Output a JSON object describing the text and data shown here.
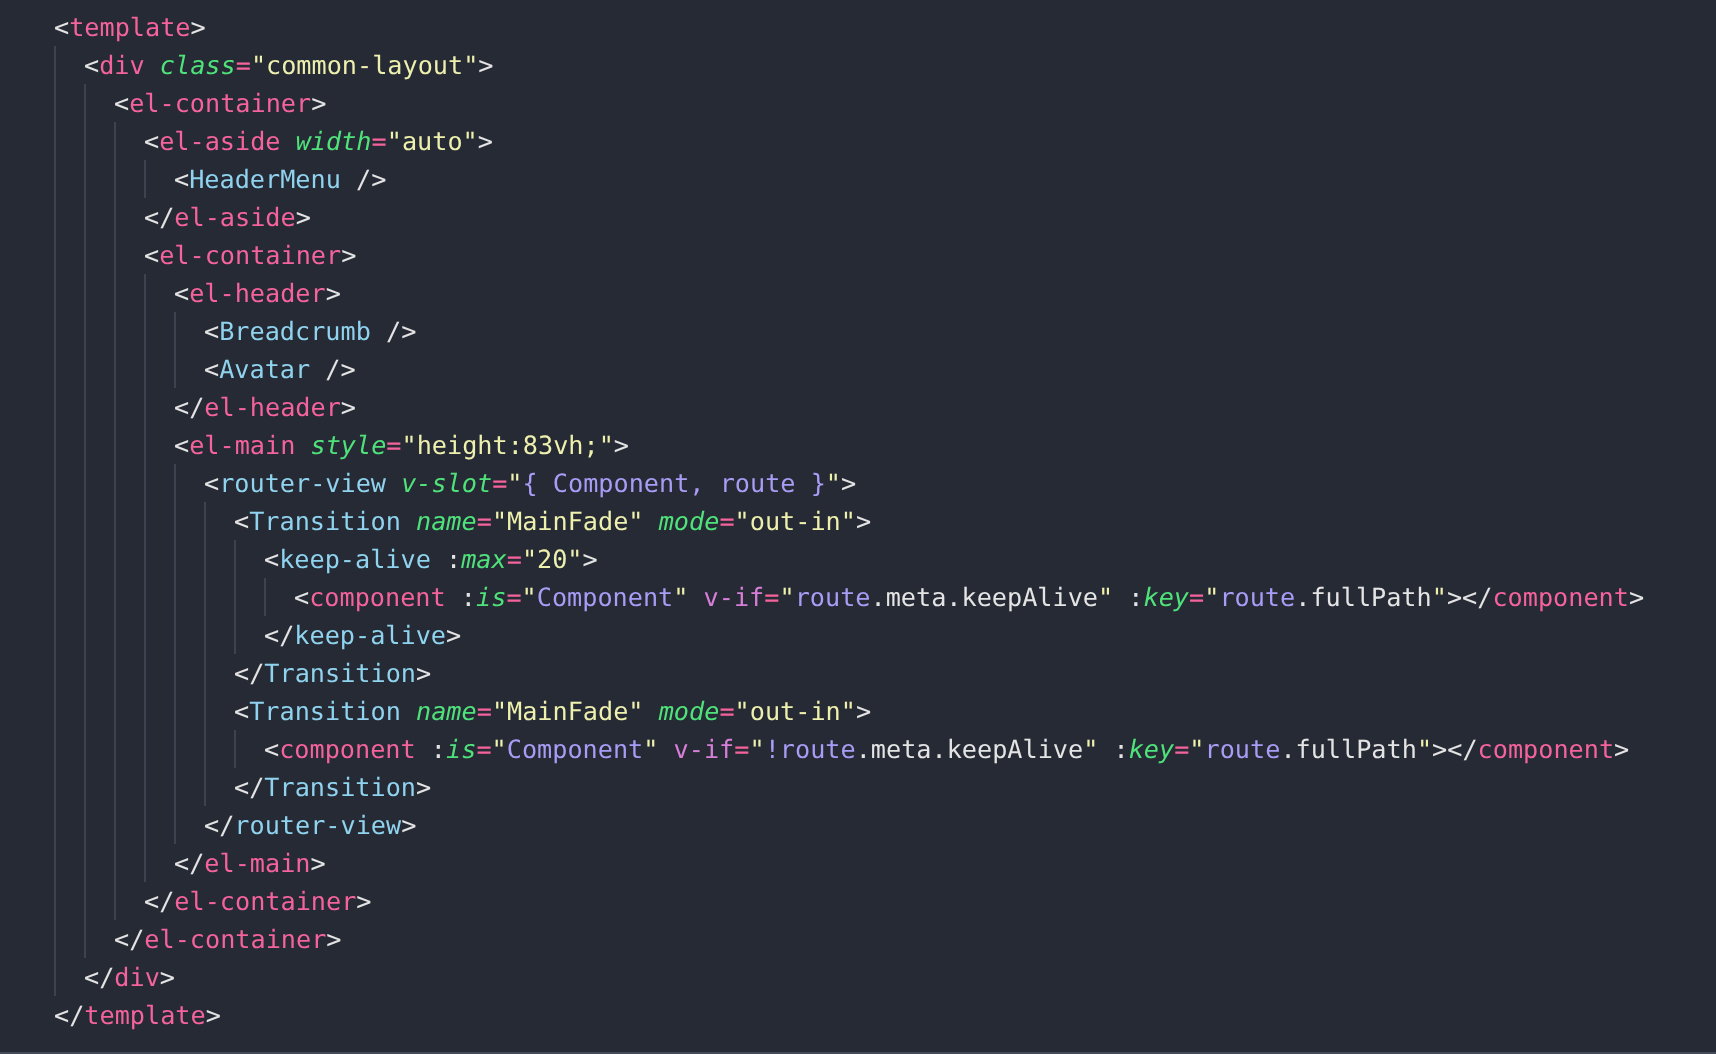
{
  "code": [
    {
      "tokens": [
        {
          "kind": "p",
          "text": "<"
        },
        {
          "kind": "tag",
          "text": "template"
        },
        {
          "kind": "p",
          "text": ">"
        }
      ],
      "children": [
        {
          "tokens": [
            {
              "kind": "p",
              "text": "<"
            },
            {
              "kind": "tag",
              "text": "div"
            },
            {
              "kind": "attr",
              "text": " class"
            },
            {
              "kind": "eq",
              "text": "="
            },
            {
              "kind": "str",
              "text": "\"common-layout\""
            },
            {
              "kind": "p",
              "text": ">"
            }
          ],
          "children": [
            {
              "tokens": [
                {
                  "kind": "p",
                  "text": "<"
                },
                {
                  "kind": "tag",
                  "text": "el-container"
                },
                {
                  "kind": "p",
                  "text": ">"
                }
              ],
              "children": [
                {
                  "tokens": [
                    {
                      "kind": "p",
                      "text": "<"
                    },
                    {
                      "kind": "tag",
                      "text": "el-aside"
                    },
                    {
                      "kind": "attr",
                      "text": " width"
                    },
                    {
                      "kind": "eq",
                      "text": "="
                    },
                    {
                      "kind": "str",
                      "text": "\"auto\""
                    },
                    {
                      "kind": "p",
                      "text": ">"
                    }
                  ],
                  "children": [
                    {
                      "tokens": [
                        {
                          "kind": "p",
                          "text": "<"
                        },
                        {
                          "kind": "comp",
                          "text": "HeaderMenu"
                        },
                        {
                          "kind": "p",
                          "text": " />"
                        }
                      ]
                    }
                  ]
                },
                {
                  "tokens": [
                    {
                      "kind": "p",
                      "text": "</"
                    },
                    {
                      "kind": "tag",
                      "text": "el-aside"
                    },
                    {
                      "kind": "p",
                      "text": ">"
                    }
                  ]
                },
                {
                  "tokens": [
                    {
                      "kind": "p",
                      "text": "<"
                    },
                    {
                      "kind": "tag",
                      "text": "el-container"
                    },
                    {
                      "kind": "p",
                      "text": ">"
                    }
                  ],
                  "children": [
                    {
                      "tokens": [
                        {
                          "kind": "p",
                          "text": "<"
                        },
                        {
                          "kind": "tag",
                          "text": "el-header"
                        },
                        {
                          "kind": "p",
                          "text": ">"
                        }
                      ],
                      "children": [
                        {
                          "tokens": [
                            {
                              "kind": "p",
                              "text": "<"
                            },
                            {
                              "kind": "comp",
                              "text": "Breadcrumb"
                            },
                            {
                              "kind": "p",
                              "text": " />"
                            }
                          ]
                        },
                        {
                          "tokens": [
                            {
                              "kind": "p",
                              "text": "<"
                            },
                            {
                              "kind": "comp",
                              "text": "Avatar"
                            },
                            {
                              "kind": "p",
                              "text": " />"
                            }
                          ]
                        }
                      ]
                    },
                    {
                      "tokens": [
                        {
                          "kind": "p",
                          "text": "</"
                        },
                        {
                          "kind": "tag",
                          "text": "el-header"
                        },
                        {
                          "kind": "p",
                          "text": ">"
                        }
                      ]
                    },
                    {
                      "tokens": [
                        {
                          "kind": "p",
                          "text": "<"
                        },
                        {
                          "kind": "tag",
                          "text": "el-main"
                        },
                        {
                          "kind": "attr",
                          "text": " style"
                        },
                        {
                          "kind": "eq",
                          "text": "="
                        },
                        {
                          "kind": "str",
                          "text": "\"height:83vh;\""
                        },
                        {
                          "kind": "p",
                          "text": ">"
                        }
                      ],
                      "children": [
                        {
                          "tokens": [
                            {
                              "kind": "p",
                              "text": "<"
                            },
                            {
                              "kind": "comp",
                              "text": "router-view"
                            },
                            {
                              "kind": "attr",
                              "text": " v-slot"
                            },
                            {
                              "kind": "eq",
                              "text": "="
                            },
                            {
                              "kind": "str",
                              "text": "\""
                            },
                            {
                              "kind": "expr",
                              "text": "{ Component, route }"
                            },
                            {
                              "kind": "str",
                              "text": "\""
                            },
                            {
                              "kind": "p",
                              "text": ">"
                            }
                          ],
                          "children": [
                            {
                              "tokens": [
                                {
                                  "kind": "p",
                                  "text": "<"
                                },
                                {
                                  "kind": "comp",
                                  "text": "Transition"
                                },
                                {
                                  "kind": "attr",
                                  "text": " name"
                                },
                                {
                                  "kind": "eq",
                                  "text": "="
                                },
                                {
                                  "kind": "str",
                                  "text": "\"MainFade\""
                                },
                                {
                                  "kind": "attr",
                                  "text": " mode"
                                },
                                {
                                  "kind": "eq",
                                  "text": "="
                                },
                                {
                                  "kind": "str",
                                  "text": "\"out-in\""
                                },
                                {
                                  "kind": "p",
                                  "text": ">"
                                }
                              ],
                              "children": [
                                {
                                  "tokens": [
                                    {
                                      "kind": "p",
                                      "text": "<"
                                    },
                                    {
                                      "kind": "comp",
                                      "text": "keep-alive"
                                    },
                                    {
                                      "kind": "p",
                                      "text": " :"
                                    },
                                    {
                                      "kind": "attr",
                                      "text": "max"
                                    },
                                    {
                                      "kind": "eq",
                                      "text": "="
                                    },
                                    {
                                      "kind": "str",
                                      "text": "\"20\""
                                    },
                                    {
                                      "kind": "p",
                                      "text": ">"
                                    }
                                  ],
                                  "children": [
                                    {
                                      "tokens": [
                                        {
                                          "kind": "p",
                                          "text": "<"
                                        },
                                        {
                                          "kind": "tag",
                                          "text": "component"
                                        },
                                        {
                                          "kind": "p",
                                          "text": " :"
                                        },
                                        {
                                          "kind": "attr",
                                          "text": "is"
                                        },
                                        {
                                          "kind": "eq",
                                          "text": "="
                                        },
                                        {
                                          "kind": "str",
                                          "text": "\""
                                        },
                                        {
                                          "kind": "expr",
                                          "text": "Component"
                                        },
                                        {
                                          "kind": "str",
                                          "text": "\""
                                        },
                                        {
                                          "kind": "dir",
                                          "text": " v-if"
                                        },
                                        {
                                          "kind": "eq",
                                          "text": "="
                                        },
                                        {
                                          "kind": "str",
                                          "text": "\""
                                        },
                                        {
                                          "kind": "expr",
                                          "text": "route"
                                        },
                                        {
                                          "kind": "p",
                                          "text": ".meta.keepAlive"
                                        },
                                        {
                                          "kind": "str",
                                          "text": "\""
                                        },
                                        {
                                          "kind": "p",
                                          "text": " :"
                                        },
                                        {
                                          "kind": "attr",
                                          "text": "key"
                                        },
                                        {
                                          "kind": "eq",
                                          "text": "="
                                        },
                                        {
                                          "kind": "str",
                                          "text": "\""
                                        },
                                        {
                                          "kind": "expr",
                                          "text": "route"
                                        },
                                        {
                                          "kind": "p",
                                          "text": ".fullPath"
                                        },
                                        {
                                          "kind": "str",
                                          "text": "\""
                                        },
                                        {
                                          "kind": "p",
                                          "text": "></"
                                        },
                                        {
                                          "kind": "tag",
                                          "text": "component"
                                        },
                                        {
                                          "kind": "p",
                                          "text": ">"
                                        }
                                      ]
                                    }
                                  ]
                                },
                                {
                                  "tokens": [
                                    {
                                      "kind": "p",
                                      "text": "</"
                                    },
                                    {
                                      "kind": "comp",
                                      "text": "keep-alive"
                                    },
                                    {
                                      "kind": "p",
                                      "text": ">"
                                    }
                                  ]
                                }
                              ]
                            },
                            {
                              "tokens": [
                                {
                                  "kind": "p",
                                  "text": "</"
                                },
                                {
                                  "kind": "comp",
                                  "text": "Transition"
                                },
                                {
                                  "kind": "p",
                                  "text": ">"
                                }
                              ]
                            },
                            {
                              "tokens": [
                                {
                                  "kind": "p",
                                  "text": "<"
                                },
                                {
                                  "kind": "comp",
                                  "text": "Transition"
                                },
                                {
                                  "kind": "attr",
                                  "text": " name"
                                },
                                {
                                  "kind": "eq",
                                  "text": "="
                                },
                                {
                                  "kind": "str",
                                  "text": "\"MainFade\""
                                },
                                {
                                  "kind": "attr",
                                  "text": " mode"
                                },
                                {
                                  "kind": "eq",
                                  "text": "="
                                },
                                {
                                  "kind": "str",
                                  "text": "\"out-in\""
                                },
                                {
                                  "kind": "p",
                                  "text": ">"
                                }
                              ],
                              "children": [
                                {
                                  "tokens": [
                                    {
                                      "kind": "p",
                                      "text": "<"
                                    },
                                    {
                                      "kind": "tag",
                                      "text": "component"
                                    },
                                    {
                                      "kind": "p",
                                      "text": " :"
                                    },
                                    {
                                      "kind": "attr",
                                      "text": "is"
                                    },
                                    {
                                      "kind": "eq",
                                      "text": "="
                                    },
                                    {
                                      "kind": "str",
                                      "text": "\""
                                    },
                                    {
                                      "kind": "expr",
                                      "text": "Component"
                                    },
                                    {
                                      "kind": "str",
                                      "text": "\""
                                    },
                                    {
                                      "kind": "dir",
                                      "text": " v-if"
                                    },
                                    {
                                      "kind": "eq",
                                      "text": "="
                                    },
                                    {
                                      "kind": "str",
                                      "text": "\""
                                    },
                                    {
                                      "kind": "expr",
                                      "text": "!route"
                                    },
                                    {
                                      "kind": "p",
                                      "text": ".meta.keepAlive"
                                    },
                                    {
                                      "kind": "str",
                                      "text": "\""
                                    },
                                    {
                                      "kind": "p",
                                      "text": " :"
                                    },
                                    {
                                      "kind": "attr",
                                      "text": "key"
                                    },
                                    {
                                      "kind": "eq",
                                      "text": "="
                                    },
                                    {
                                      "kind": "str",
                                      "text": "\""
                                    },
                                    {
                                      "kind": "expr",
                                      "text": "route"
                                    },
                                    {
                                      "kind": "p",
                                      "text": ".fullPath"
                                    },
                                    {
                                      "kind": "str",
                                      "text": "\""
                                    },
                                    {
                                      "kind": "p",
                                      "text": "></"
                                    },
                                    {
                                      "kind": "tag",
                                      "text": "component"
                                    },
                                    {
                                      "kind": "p",
                                      "text": ">"
                                    }
                                  ]
                                }
                              ]
                            },
                            {
                              "tokens": [
                                {
                                  "kind": "p",
                                  "text": "</"
                                },
                                {
                                  "kind": "comp",
                                  "text": "Transition"
                                },
                                {
                                  "kind": "p",
                                  "text": ">"
                                }
                              ]
                            }
                          ]
                        },
                        {
                          "tokens": [
                            {
                              "kind": "p",
                              "text": "</"
                            },
                            {
                              "kind": "comp",
                              "text": "router-view"
                            },
                            {
                              "kind": "p",
                              "text": ">"
                            }
                          ]
                        }
                      ]
                    },
                    {
                      "tokens": [
                        {
                          "kind": "p",
                          "text": "</"
                        },
                        {
                          "kind": "tag",
                          "text": "el-main"
                        },
                        {
                          "kind": "p",
                          "text": ">"
                        }
                      ]
                    }
                  ]
                },
                {
                  "tokens": [
                    {
                      "kind": "p",
                      "text": "</"
                    },
                    {
                      "kind": "tag",
                      "text": "el-container"
                    },
                    {
                      "kind": "p",
                      "text": ">"
                    }
                  ]
                }
              ]
            },
            {
              "tokens": [
                {
                  "kind": "p",
                  "text": "</"
                },
                {
                  "kind": "tag",
                  "text": "el-container"
                },
                {
                  "kind": "p",
                  "text": ">"
                }
              ]
            }
          ]
        },
        {
          "tokens": [
            {
              "kind": "p",
              "text": "</"
            },
            {
              "kind": "tag",
              "text": "div"
            },
            {
              "kind": "p",
              "text": ">"
            }
          ]
        }
      ]
    },
    {
      "tokens": [
        {
          "kind": "p",
          "text": "</"
        },
        {
          "kind": "tag",
          "text": "template"
        },
        {
          "kind": "p",
          "text": ">"
        }
      ]
    }
  ]
}
